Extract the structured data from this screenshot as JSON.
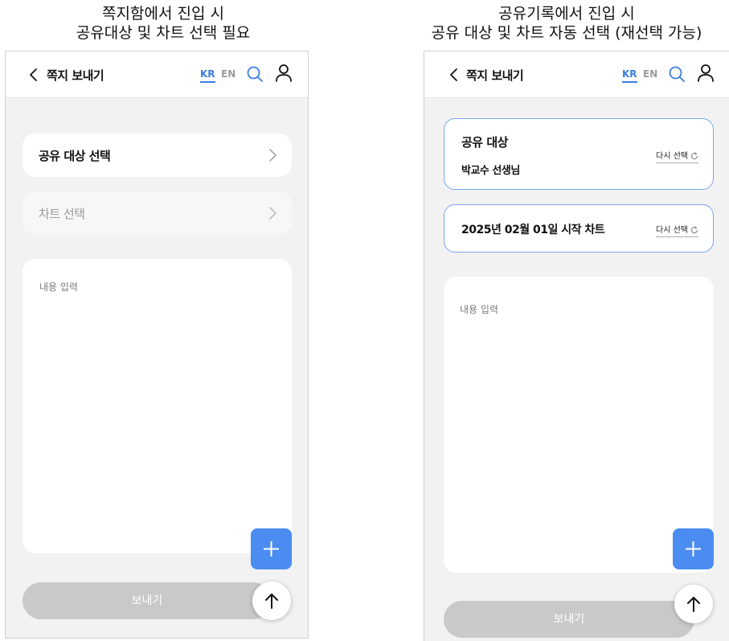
{
  "captions": {
    "left": [
      "쪽지함에서 진입 시",
      "공유대상 및 차트 선택 필요"
    ],
    "right": [
      "공유기록에서 진입 시",
      "공유 대상 및 차트 자동 선택 (재선택 가능)"
    ]
  },
  "header": {
    "title": "쪽지 보내기",
    "lang_kr": "KR",
    "lang_en": "EN",
    "active_lang": "KR",
    "icons": [
      "chevron-left-icon",
      "search-icon",
      "user-icon"
    ]
  },
  "left_screen": {
    "recipient_row": {
      "label": "공유 대상 선택"
    },
    "chart_row": {
      "label": "차트 선택",
      "enabled": false
    },
    "content": {
      "placeholder": "내용 입력"
    },
    "send_label": "보내기"
  },
  "right_screen": {
    "recipient_card": {
      "title": "공유 대상",
      "value": "박교수 선생님",
      "reselect_label": "다시 선택"
    },
    "chart_card": {
      "title": "2025년 02월 01일 시작 차트",
      "reselect_label": "다시 선택"
    },
    "content": {
      "placeholder": "내용 입력"
    },
    "send_label": "보내기"
  },
  "colors": {
    "accent": "#3b7de0",
    "fab": "#4a8cf0",
    "selected_border": "#7aa6ee",
    "disabled_button": "#c9c9c9",
    "screen_background": "#f2f2f2"
  }
}
